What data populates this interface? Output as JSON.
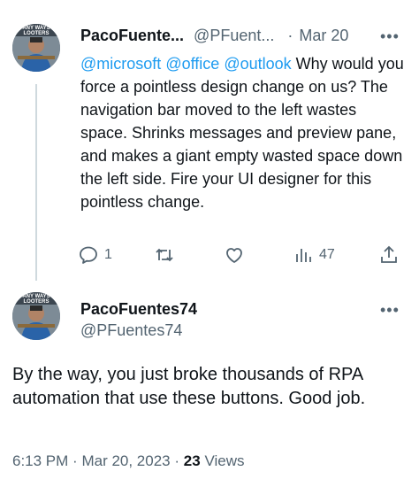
{
  "reply_tweet": {
    "display_name": "PacoFuente...",
    "handle": "@PFuent...",
    "separator": "·",
    "date": "Mar 20",
    "more_label": "•••",
    "mentions": [
      "@microsoft",
      "@office",
      "@outlook"
    ],
    "text": "Why would you force a pointless design change on us? The navigation bar moved to the left wastes space. Shrinks messages and preview pane, and makes a giant empty wasted space down the left side. Fire your UI designer for this pointless change.",
    "reply_count": "1",
    "views_count": "47",
    "avatar_caption": "ANY WAYS LOOTERS"
  },
  "main_tweet": {
    "display_name": "PacoFuentes74",
    "handle": "@PFuentes74",
    "more_label": "•••",
    "text": "By the way, you just broke thousands of RPA automation that use these buttons. Good job.",
    "time": "6:13 PM",
    "separator1": "·",
    "date": "Mar 20, 2023",
    "separator2": "·",
    "views_count": "23",
    "views_label": "Views",
    "avatar_caption": "ANY WAYS LOOTERS"
  },
  "colors": {
    "accent": "#1d9bf0",
    "text": "#0f1419",
    "muted": "#536471",
    "thread_line": "#cfd9de"
  },
  "icons": [
    "reply-icon",
    "retweet-icon",
    "like-icon",
    "views-icon",
    "share-icon"
  ]
}
